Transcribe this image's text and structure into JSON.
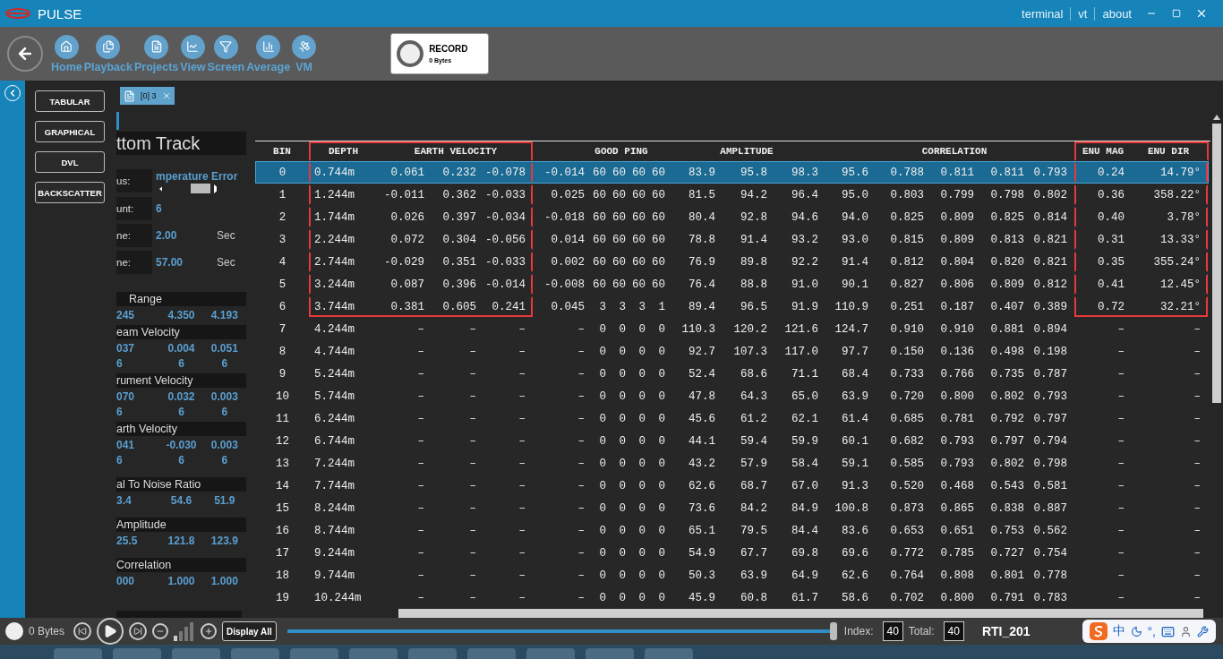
{
  "window": {
    "title": "PULSE",
    "links": [
      "terminal",
      "vt",
      "about"
    ]
  },
  "toolbar": {
    "items": [
      "Home",
      "Playback",
      "Projects",
      "View",
      "Screen",
      "Average",
      "VM"
    ],
    "record": {
      "label": "RECORD",
      "size": "0 Bytes"
    }
  },
  "view_buttons": [
    "TABULAR",
    "GRAPHICAL",
    "DVL",
    "BACKSCATTER"
  ],
  "document_tab": {
    "label": "[0] 3"
  },
  "bottom_track": {
    "title": "ttom Track",
    "status": [
      {
        "label": "us:",
        "value": "mperature Error"
      },
      {
        "label": "unt:",
        "value": "6"
      },
      {
        "label": "ne:",
        "value": "2.00",
        "unit": "Sec"
      },
      {
        "label": "ne:",
        "value": "57.00",
        "unit": "Sec"
      }
    ],
    "sections": [
      {
        "title": "Range",
        "rows": [
          [
            "245",
            "4.350",
            "4.193"
          ]
        ]
      },
      {
        "title": "eam Velocity",
        "rows": [
          [
            "037",
            "0.004",
            "0.051"
          ],
          [
            "6",
            "6",
            "6"
          ]
        ]
      },
      {
        "title": "rument Velocity",
        "rows": [
          [
            "070",
            "0.032",
            "0.003"
          ],
          [
            "6",
            "6",
            "6"
          ]
        ]
      },
      {
        "title": "arth Velocity",
        "rows": [
          [
            "041",
            "-0.030",
            "0.003"
          ],
          [
            "6",
            "6",
            "6"
          ]
        ]
      },
      {
        "title": "al To Noise Ratio",
        "rows": [
          [
            "3.4",
            "54.6",
            "51.9"
          ]
        ]
      },
      {
        "title": "Amplitude",
        "rows": [
          [
            "25.5",
            "121.8",
            "123.9"
          ]
        ]
      },
      {
        "title": "Correlation",
        "rows": [
          [
            "000",
            "1.000",
            "1.000"
          ]
        ]
      }
    ]
  },
  "table": {
    "column_groups": [
      {
        "outlined": false,
        "columns": [
          "BIN"
        ]
      },
      {
        "outlined": true,
        "columns": [
          "DEPTH",
          null,
          "EARTH VELOCITY",
          null
        ]
      },
      {
        "outlined": false,
        "columns": [
          null,
          null,
          "GOOD PING",
          null,
          null,
          null,
          "AMPLITUDE",
          null,
          null,
          null,
          "CORRELATION",
          null,
          null
        ]
      },
      {
        "outlined": true,
        "columns": [
          "ENU MAG",
          "ENU DIR"
        ]
      }
    ],
    "rows": [
      {
        "selected": true,
        "outlined": true,
        "cells": [
          "0",
          "0.744m",
          "0.061",
          "0.232",
          "-0.078",
          "-0.014",
          "60",
          "60",
          "60",
          "60",
          "83.9",
          "95.8",
          "98.3",
          "95.6",
          "0.788",
          "0.811",
          "0.811",
          "0.793",
          "0.24",
          "14.79°"
        ]
      },
      {
        "selected": false,
        "outlined": true,
        "cells": [
          "1",
          "1.244m",
          "-0.011",
          "0.362",
          "-0.033",
          "0.025",
          "60",
          "60",
          "60",
          "60",
          "81.5",
          "94.2",
          "96.4",
          "95.0",
          "0.803",
          "0.799",
          "0.798",
          "0.802",
          "0.36",
          "358.22°"
        ]
      },
      {
        "selected": false,
        "outlined": true,
        "cells": [
          "2",
          "1.744m",
          "0.026",
          "0.397",
          "-0.034",
          "-0.018",
          "60",
          "60",
          "60",
          "60",
          "80.4",
          "92.8",
          "94.6",
          "94.0",
          "0.825",
          "0.809",
          "0.825",
          "0.814",
          "0.40",
          "3.78°"
        ]
      },
      {
        "selected": false,
        "outlined": true,
        "cells": [
          "3",
          "2.244m",
          "0.072",
          "0.304",
          "-0.056",
          "0.014",
          "60",
          "60",
          "60",
          "60",
          "78.8",
          "91.4",
          "93.2",
          "93.0",
          "0.815",
          "0.809",
          "0.813",
          "0.821",
          "0.31",
          "13.33°"
        ]
      },
      {
        "selected": false,
        "outlined": true,
        "cells": [
          "4",
          "2.744m",
          "-0.029",
          "0.351",
          "-0.033",
          "0.002",
          "60",
          "60",
          "60",
          "60",
          "76.9",
          "89.8",
          "92.2",
          "91.4",
          "0.812",
          "0.804",
          "0.820",
          "0.821",
          "0.35",
          "355.24°"
        ]
      },
      {
        "selected": false,
        "outlined": true,
        "cells": [
          "5",
          "3.244m",
          "0.087",
          "0.396",
          "-0.014",
          "-0.008",
          "60",
          "60",
          "60",
          "60",
          "76.4",
          "88.8",
          "91.0",
          "90.1",
          "0.827",
          "0.806",
          "0.809",
          "0.812",
          "0.41",
          "12.45°"
        ]
      },
      {
        "selected": false,
        "outlined": true,
        "cells": [
          "6",
          "3.744m",
          "0.381",
          "0.605",
          "0.241",
          "0.045",
          "3",
          "3",
          "3",
          "1",
          "89.4",
          "96.5",
          "91.9",
          "110.9",
          "0.251",
          "0.187",
          "0.407",
          "0.389",
          "0.72",
          "32.21°"
        ]
      },
      {
        "selected": false,
        "outlined": false,
        "cells": [
          "7",
          "4.244m",
          "–",
          "–",
          "–",
          "–",
          "0",
          "0",
          "0",
          "0",
          "110.3",
          "120.2",
          "121.6",
          "124.7",
          "0.910",
          "0.910",
          "0.881",
          "0.894",
          "–",
          "–"
        ]
      },
      {
        "selected": false,
        "outlined": false,
        "cells": [
          "8",
          "4.744m",
          "–",
          "–",
          "–",
          "–",
          "0",
          "0",
          "0",
          "0",
          "92.7",
          "107.3",
          "117.0",
          "97.7",
          "0.150",
          "0.136",
          "0.498",
          "0.198",
          "–",
          "–"
        ]
      },
      {
        "selected": false,
        "outlined": false,
        "cells": [
          "9",
          "5.244m",
          "–",
          "–",
          "–",
          "–",
          "0",
          "0",
          "0",
          "0",
          "52.4",
          "68.6",
          "71.1",
          "68.4",
          "0.733",
          "0.766",
          "0.735",
          "0.787",
          "–",
          "–"
        ]
      },
      {
        "selected": false,
        "outlined": false,
        "cells": [
          "10",
          "5.744m",
          "–",
          "–",
          "–",
          "–",
          "0",
          "0",
          "0",
          "0",
          "47.8",
          "64.3",
          "65.0",
          "63.9",
          "0.720",
          "0.800",
          "0.802",
          "0.793",
          "–",
          "–"
        ]
      },
      {
        "selected": false,
        "outlined": false,
        "cells": [
          "11",
          "6.244m",
          "–",
          "–",
          "–",
          "–",
          "0",
          "0",
          "0",
          "0",
          "45.6",
          "61.2",
          "62.1",
          "61.4",
          "0.685",
          "0.781",
          "0.792",
          "0.797",
          "–",
          "–"
        ]
      },
      {
        "selected": false,
        "outlined": false,
        "cells": [
          "12",
          "6.744m",
          "–",
          "–",
          "–",
          "–",
          "0",
          "0",
          "0",
          "0",
          "44.1",
          "59.4",
          "59.9",
          "60.1",
          "0.682",
          "0.793",
          "0.797",
          "0.794",
          "–",
          "–"
        ]
      },
      {
        "selected": false,
        "outlined": false,
        "cells": [
          "13",
          "7.244m",
          "–",
          "–",
          "–",
          "–",
          "0",
          "0",
          "0",
          "0",
          "43.2",
          "57.9",
          "58.4",
          "59.1",
          "0.585",
          "0.793",
          "0.802",
          "0.798",
          "–",
          "–"
        ]
      },
      {
        "selected": false,
        "outlined": false,
        "cells": [
          "14",
          "7.744m",
          "–",
          "–",
          "–",
          "–",
          "0",
          "0",
          "0",
          "0",
          "62.6",
          "68.7",
          "67.0",
          "91.3",
          "0.520",
          "0.468",
          "0.543",
          "0.581",
          "–",
          "–"
        ]
      },
      {
        "selected": false,
        "outlined": false,
        "cells": [
          "15",
          "8.244m",
          "–",
          "–",
          "–",
          "–",
          "0",
          "0",
          "0",
          "0",
          "73.6",
          "84.2",
          "84.9",
          "100.8",
          "0.873",
          "0.865",
          "0.838",
          "0.887",
          "–",
          "–"
        ]
      },
      {
        "selected": false,
        "outlined": false,
        "cells": [
          "16",
          "8.744m",
          "–",
          "–",
          "–",
          "–",
          "0",
          "0",
          "0",
          "0",
          "65.1",
          "79.5",
          "84.4",
          "83.6",
          "0.653",
          "0.651",
          "0.753",
          "0.562",
          "–",
          "–"
        ]
      },
      {
        "selected": false,
        "outlined": false,
        "cells": [
          "17",
          "9.244m",
          "–",
          "–",
          "–",
          "–",
          "0",
          "0",
          "0",
          "0",
          "54.9",
          "67.7",
          "69.8",
          "69.6",
          "0.772",
          "0.785",
          "0.727",
          "0.754",
          "–",
          "–"
        ]
      },
      {
        "selected": false,
        "outlined": false,
        "cells": [
          "18",
          "9.744m",
          "–",
          "–",
          "–",
          "–",
          "0",
          "0",
          "0",
          "0",
          "50.3",
          "63.9",
          "64.9",
          "62.6",
          "0.764",
          "0.808",
          "0.801",
          "0.778",
          "–",
          "–"
        ]
      },
      {
        "selected": false,
        "outlined": false,
        "cells": [
          "19",
          "10.244m",
          "–",
          "–",
          "–",
          "–",
          "0",
          "0",
          "0",
          "0",
          "45.9",
          "60.8",
          "61.7",
          "58.6",
          "0.702",
          "0.800",
          "0.791",
          "0.783",
          "–",
          "–"
        ]
      }
    ]
  },
  "player": {
    "size": "0 Bytes",
    "display_button": "Display All",
    "level": 1,
    "index_label": "Index:",
    "index": "40",
    "total_label": "Total:",
    "total": "40",
    "file": "RTI_201"
  },
  "ime_bar": {
    "language": "中",
    "punctuation": "°,"
  }
}
